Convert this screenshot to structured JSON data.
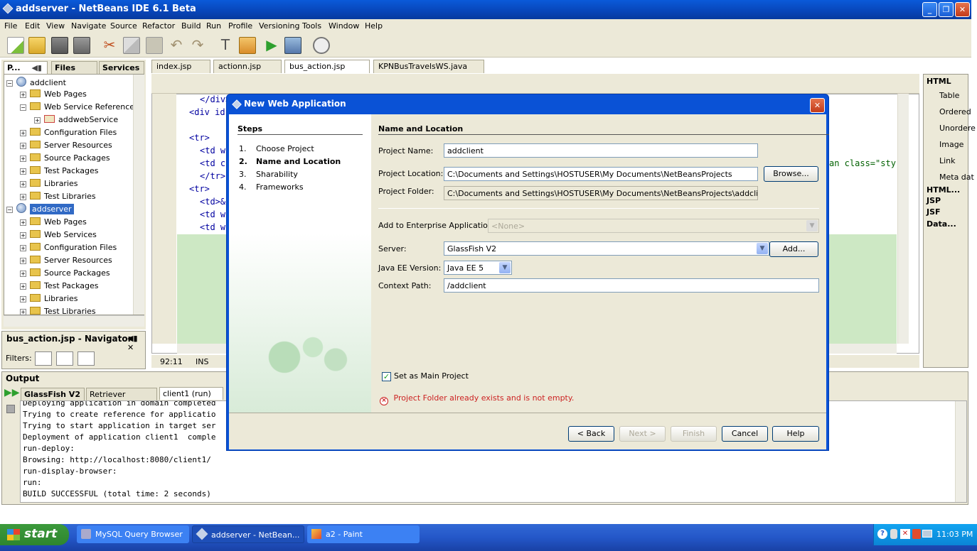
{
  "window": {
    "title": "addserver - NetBeans IDE 6.1 Beta"
  },
  "menu": [
    "File",
    "Edit",
    "View",
    "Navigate",
    "Source",
    "Refactor",
    "Build",
    "Run",
    "Profile",
    "Versioning",
    "Tools",
    "Window",
    "Help"
  ],
  "left_panel": {
    "tabs": [
      "P...",
      "Files",
      "Services"
    ],
    "tree": [
      {
        "label": "addclient",
        "type": "project",
        "indent": 0
      },
      {
        "label": "Web Pages",
        "type": "folder",
        "indent": 1
      },
      {
        "label": "Web Service References",
        "type": "folder",
        "indent": 1
      },
      {
        "label": "addwebService",
        "type": "ref",
        "indent": 2
      },
      {
        "label": "Configuration Files",
        "type": "folder",
        "indent": 1
      },
      {
        "label": "Server Resources",
        "type": "folder",
        "indent": 1
      },
      {
        "label": "Source Packages",
        "type": "folder",
        "indent": 1
      },
      {
        "label": "Test Packages",
        "type": "folder",
        "indent": 1
      },
      {
        "label": "Libraries",
        "type": "folder",
        "indent": 1
      },
      {
        "label": "Test Libraries",
        "type": "folder",
        "indent": 1
      },
      {
        "label": "addserver",
        "type": "project",
        "indent": 0,
        "selected": true
      },
      {
        "label": "Web Pages",
        "type": "folder",
        "indent": 1
      },
      {
        "label": "Web Services",
        "type": "folder",
        "indent": 1
      },
      {
        "label": "Configuration Files",
        "type": "folder",
        "indent": 1
      },
      {
        "label": "Server Resources",
        "type": "folder",
        "indent": 1
      },
      {
        "label": "Source Packages",
        "type": "folder",
        "indent": 1
      },
      {
        "label": "Test Packages",
        "type": "folder",
        "indent": 1
      },
      {
        "label": "Libraries",
        "type": "folder",
        "indent": 1
      },
      {
        "label": "Test Libraries",
        "type": "folder",
        "indent": 1
      }
    ]
  },
  "navigator": {
    "title": "bus_action.jsp - Navigator",
    "filters_label": "Filters:"
  },
  "editor": {
    "tabs": [
      "index.jsp",
      "actionn.jsp",
      "bus_action.jsp",
      "KPNBusTravelsWS.java"
    ],
    "active_tab": "bus_action.jsp",
    "code_lines": [
      "</div>",
      "<div id",
      "<tr>",
      "<td w",
      "<td c",
      "</tr>",
      "<tr>",
      "<td>&",
      "<td w",
      "<td w"
    ],
    "snippet_right": "an class=\"sty",
    "status_position": "92:11",
    "status_mode": "INS"
  },
  "palette": {
    "header": "HTML",
    "items": [
      "Table",
      "Ordered",
      "Unordere",
      "Image",
      "Link",
      "Meta dat"
    ],
    "sections": [
      "HTML...",
      "JSP",
      "JSF",
      "Data..."
    ]
  },
  "output": {
    "title": "Output",
    "tabs": [
      "GlassFish V2",
      "Retriever Output",
      "client1 (run)"
    ],
    "lines": [
      "Deploying application in domain completed",
      "Trying to create reference for applicatio",
      "Trying to start application in target ser",
      "Deployment of application client1  comple",
      "run-deploy:",
      "Browsing: http://localhost:8080/client1/",
      "run-display-browser:",
      "run:",
      "BUILD SUCCESSFUL (total time: 2 seconds)"
    ]
  },
  "dialog": {
    "title": "New Web Application",
    "steps_header": "Steps",
    "steps": [
      {
        "num": "1.",
        "label": "Choose Project",
        "current": false
      },
      {
        "num": "2.",
        "label": "Name and Location",
        "current": true
      },
      {
        "num": "3.",
        "label": "Sharability",
        "current": false
      },
      {
        "num": "4.",
        "label": "Frameworks",
        "current": false
      }
    ],
    "section_header": "Name and Location",
    "project_name_label": "Project Name:",
    "project_name": "addclient",
    "project_location_label": "Project Location:",
    "project_location": "C:\\Documents and Settings\\HOSTUSER\\My Documents\\NetBeansProjects",
    "browse_label": "Browse...",
    "project_folder_label": "Project Folder:",
    "project_folder": "C:\\Documents and Settings\\HOSTUSER\\My Documents\\NetBeansProjects\\addclient",
    "enterprise_label": "Add to Enterprise Application:",
    "enterprise_value": "<None>",
    "server_label": "Server:",
    "server_value": "GlassFish V2",
    "add_label": "Add...",
    "javaee_label": "Java EE Version:",
    "javaee_value": "Java EE 5",
    "context_label": "Context Path:",
    "context_value": "/addclient",
    "main_project_label": "Set as Main Project",
    "main_project_checked": true,
    "error_text": "Project Folder already exists and is not empty.",
    "buttons": {
      "back": "< Back",
      "next": "Next >",
      "finish": "Finish",
      "cancel": "Cancel",
      "help": "Help"
    }
  },
  "taskbar": {
    "start_label": "start",
    "tasks": [
      "MySQL Query Browser",
      "addserver - NetBean...",
      "a2 - Paint"
    ],
    "clock": "11:03 PM"
  },
  "colors": {
    "xp_blue": "#0a52d6",
    "selection": "#316ac5",
    "error_red": "#cc2222",
    "editor_green": "#cde8c4"
  }
}
